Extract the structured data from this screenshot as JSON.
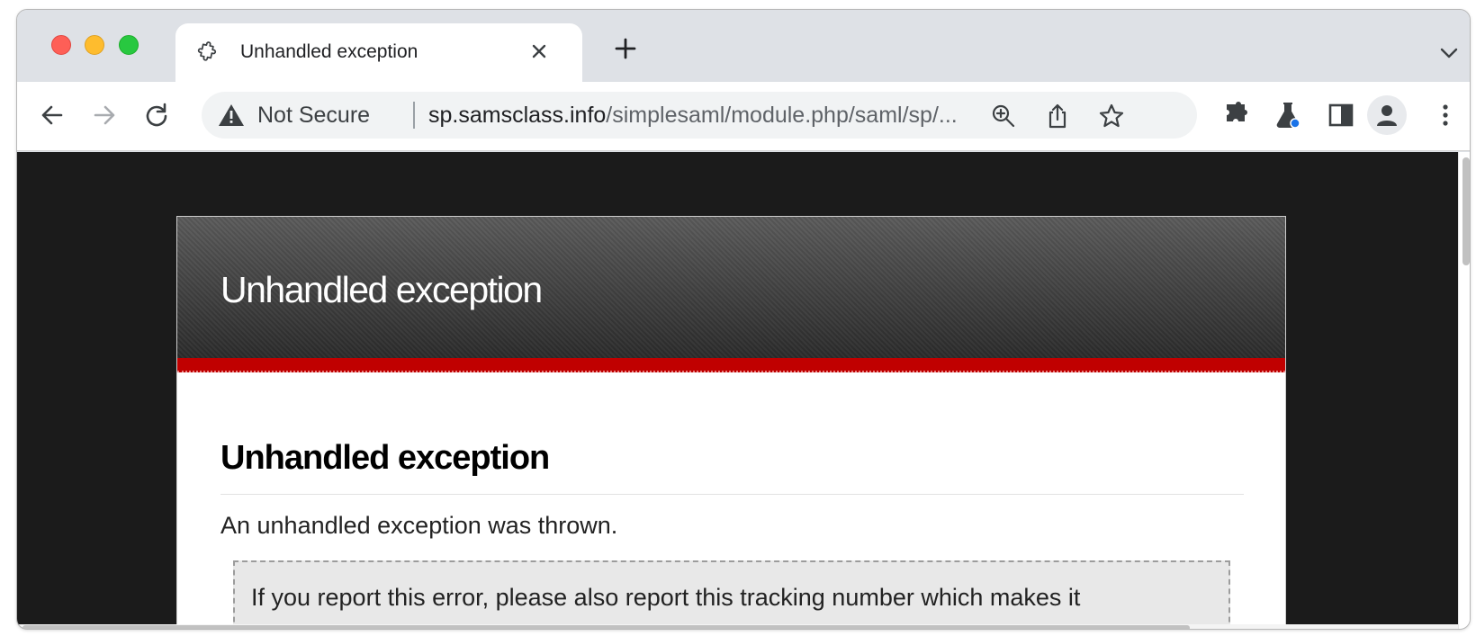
{
  "browser": {
    "tab": {
      "title": "Unhandled exception"
    },
    "address_bar": {
      "security_label": "Not Secure",
      "url_host": "sp.samsclass.info",
      "url_path": "/simplesaml/module.php/saml/sp/..."
    },
    "icons": {
      "favicon": "puzzle-outline-icon",
      "tab_close": "close-icon",
      "new_tab": "plus-icon",
      "tab_menu": "chevron-down-icon",
      "back": "arrow-left-icon",
      "forward": "arrow-right-icon",
      "reload": "reload-icon",
      "security": "warning-triangle-icon",
      "zoom": "zoom-in-icon",
      "share": "share-icon",
      "bookmark": "star-icon",
      "extensions": "puzzle-icon",
      "labs": "flask-icon",
      "side_panel": "side-panel-icon",
      "profile": "profile-avatar-icon",
      "menu": "kebab-menu-icon"
    }
  },
  "page": {
    "header_title": "Unhandled exception",
    "heading": "Unhandled exception",
    "message": "An unhandled exception was thrown.",
    "tracking_note": "If you report this error, please also report this tracking number which makes it"
  },
  "colors": {
    "header_dark": "#2b2b2b",
    "accent_red": "#c00000",
    "viewport_background": "#1b1b1b",
    "tracking_box": "#e8e8e8"
  }
}
